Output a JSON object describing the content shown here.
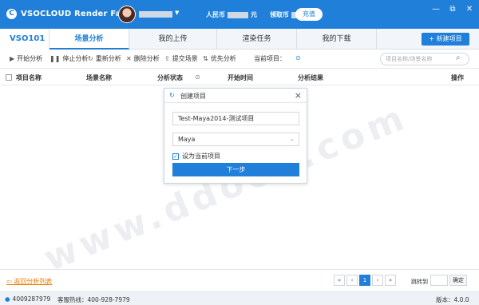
{
  "app": {
    "logo": "VSOCLOUD Render Farm",
    "balance_rmb_label": "人民币",
    "balance_rmb_unit": "元",
    "balance_credit_label": "领取币",
    "recharge": "充值",
    "window_buttons": [
      "—",
      "⧉",
      "✕"
    ]
  },
  "tabs": {
    "brand": "VSO101",
    "items": [
      "场景分析",
      "我的上传",
      "渲染任务",
      "我的下载"
    ],
    "new_project": "+ 新建项目"
  },
  "toolbar": {
    "items": [
      "开始分析",
      "停止分析",
      "重新分析",
      "删除分析",
      "提交场景",
      "优先分析"
    ],
    "current_project_label": "当前项目：",
    "search_placeholder": "项目名称/场景名称"
  },
  "table": {
    "headers": [
      "项目名称",
      "场景名称",
      "分析状态",
      "开始时间",
      "分析结果",
      "操作"
    ]
  },
  "watermark": "www.ddooo.com",
  "modal": {
    "title": "创建项目",
    "project_name": "Test-Maya2014-测试项目",
    "software": "Maya",
    "set_current": "设为当前项目",
    "next": "下一步"
  },
  "footer": {
    "back_link": "返回分析列表",
    "pages": [
      "«",
      "‹",
      "1",
      "›",
      "»"
    ],
    "current_page": "1",
    "jump_label": "跳转到",
    "jump_button": "确定"
  },
  "statusbar": {
    "qq": "4009287979",
    "hotline": "客服热线：400-928-7979",
    "version": "版本：4.0.0"
  }
}
